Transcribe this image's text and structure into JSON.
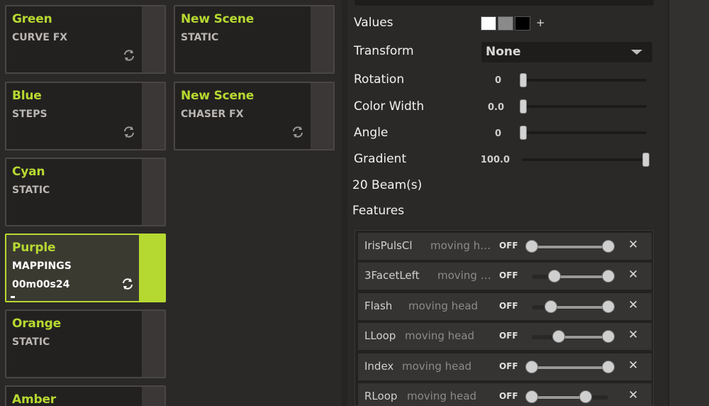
{
  "scenes": [
    {
      "name": "Green",
      "type": "CURVE FX",
      "loop": true
    },
    {
      "name": "New Scene",
      "type": "STATIC",
      "loop": false
    },
    {
      "name": "Blue",
      "type": "STEPS",
      "loop": true
    },
    {
      "name": "New Scene",
      "type": "CHASER FX",
      "loop": true
    },
    {
      "name": "Cyan",
      "type": "STATIC",
      "loop": false
    },
    {
      "name": "Purple",
      "type": "MAPPINGS",
      "time": "00m00s24",
      "loop": true,
      "active": true
    },
    {
      "name": "Orange",
      "type": "STATIC",
      "loop": false
    },
    {
      "name": "Amber",
      "type": "",
      "loop": false
    }
  ],
  "panel": {
    "values_label": "Values",
    "swatches": [
      "#ffffff",
      "#8a8a8a",
      "#000000"
    ],
    "add_label": "+",
    "transform_label": "Transform",
    "transform_value": "None",
    "rotation_label": "Rotation",
    "rotation_value": "0",
    "color_width_label": "Color Width",
    "color_width_value": "0.0",
    "angle_label": "Angle",
    "angle_value": "0",
    "gradient_label": "Gradient",
    "gradient_value": "100.0",
    "beams_label": "20 Beam(s)",
    "features_label": "Features"
  },
  "features": [
    {
      "name": "IrisPulsCl",
      "type": "moving he...",
      "state": "OFF",
      "range_low": 0.0,
      "range_high": 1.0
    },
    {
      "name": "3FacetLeft",
      "type": "moving h...",
      "state": "OFF",
      "range_low": 0.3,
      "range_high": 1.0
    },
    {
      "name": "Flash",
      "type": "moving head",
      "state": "OFF",
      "range_low": 0.25,
      "range_high": 1.0
    },
    {
      "name": "LLoop",
      "type": "moving head",
      "state": "OFF",
      "range_low": 0.35,
      "range_high": 1.0
    },
    {
      "name": "Index",
      "type": "moving head",
      "state": "OFF",
      "range_low": 0.0,
      "range_high": 1.0
    },
    {
      "name": "RLoop",
      "type": "moving head",
      "state": "OFF",
      "range_low": 0.0,
      "range_high": 0.7
    }
  ],
  "close_label": "✕",
  "colors": {
    "accent": "#b6d931",
    "background": "#2b2928"
  }
}
